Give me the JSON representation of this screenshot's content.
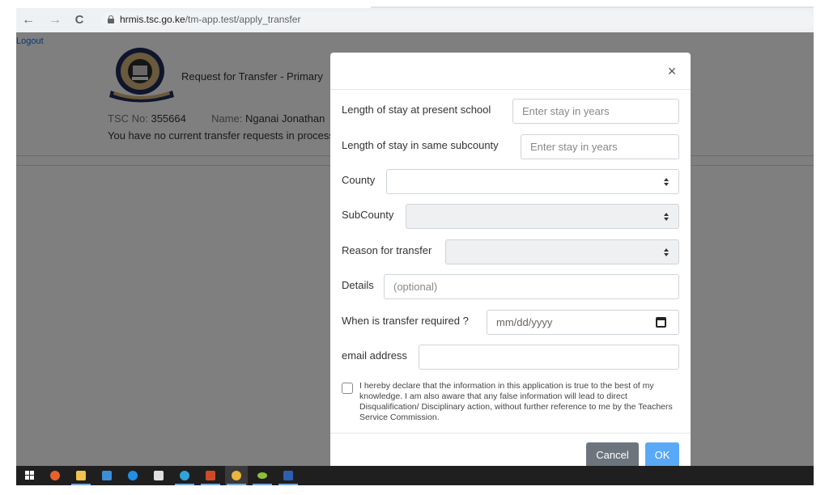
{
  "browser": {
    "url_host": "hrmis.tsc.go.ke",
    "url_path": "/tm-app.test/apply_transfer",
    "back_icon": "←",
    "forward_icon": "→",
    "reload_icon": "C"
  },
  "page": {
    "logout_label": "Logout",
    "title": "Request for Transfer - Primary",
    "tsc_label": "TSC No:",
    "tsc_value": "355664",
    "name_label": "Name:",
    "name_value": "Nganai Jonathan",
    "status_message": "You have no current transfer requests in process"
  },
  "modal": {
    "close_icon": "×",
    "fields": {
      "stay_school": {
        "label": "Length of stay at present school",
        "placeholder": "Enter stay in years",
        "value": ""
      },
      "stay_subcounty": {
        "label": "Length of stay in same subcounty",
        "placeholder": "Enter stay in years",
        "value": ""
      },
      "county": {
        "label": "County",
        "selected": ""
      },
      "subcounty": {
        "label": "SubCounty",
        "selected": ""
      },
      "reason": {
        "label": "Reason for transfer",
        "selected": ""
      },
      "details": {
        "label": "Details",
        "placeholder": "(optional)",
        "value": ""
      },
      "date_required": {
        "label": "When is transfer required ?",
        "placeholder": "mm/dd/yyyy"
      },
      "email": {
        "label": "email address",
        "placeholder": "",
        "value": ""
      }
    },
    "declaration": {
      "checked": false,
      "text": "I hereby declare that the information in this application is true to the best of my knowledge. I am also aware that any false information will lead to direct Disqualification/ Disciplinary action, without further reference to me by the Teachers Service Commission."
    },
    "buttons": {
      "cancel": "Cancel",
      "ok": "OK"
    },
    "colors": {
      "cancel_bg": "#6c757d",
      "ok_bg": "#5aa9f8"
    }
  },
  "taskbar": {
    "items": [
      {
        "name": "start",
        "color": "#ffffff"
      },
      {
        "name": "firefox",
        "color": "#e8612c"
      },
      {
        "name": "file-explorer",
        "color": "#f2c14e"
      },
      {
        "name": "mail",
        "color": "#3b8ed8"
      },
      {
        "name": "skype",
        "color": "#1e90e8"
      },
      {
        "name": "store",
        "color": "#e0e0e0"
      },
      {
        "name": "edge",
        "color": "#2fa4d9"
      },
      {
        "name": "powerpoint",
        "color": "#d04a2a"
      },
      {
        "name": "chrome",
        "color": "#e9b53a"
      },
      {
        "name": "app-green",
        "color": "#8fbf3a"
      },
      {
        "name": "word",
        "color": "#2b5fb0"
      }
    ]
  }
}
